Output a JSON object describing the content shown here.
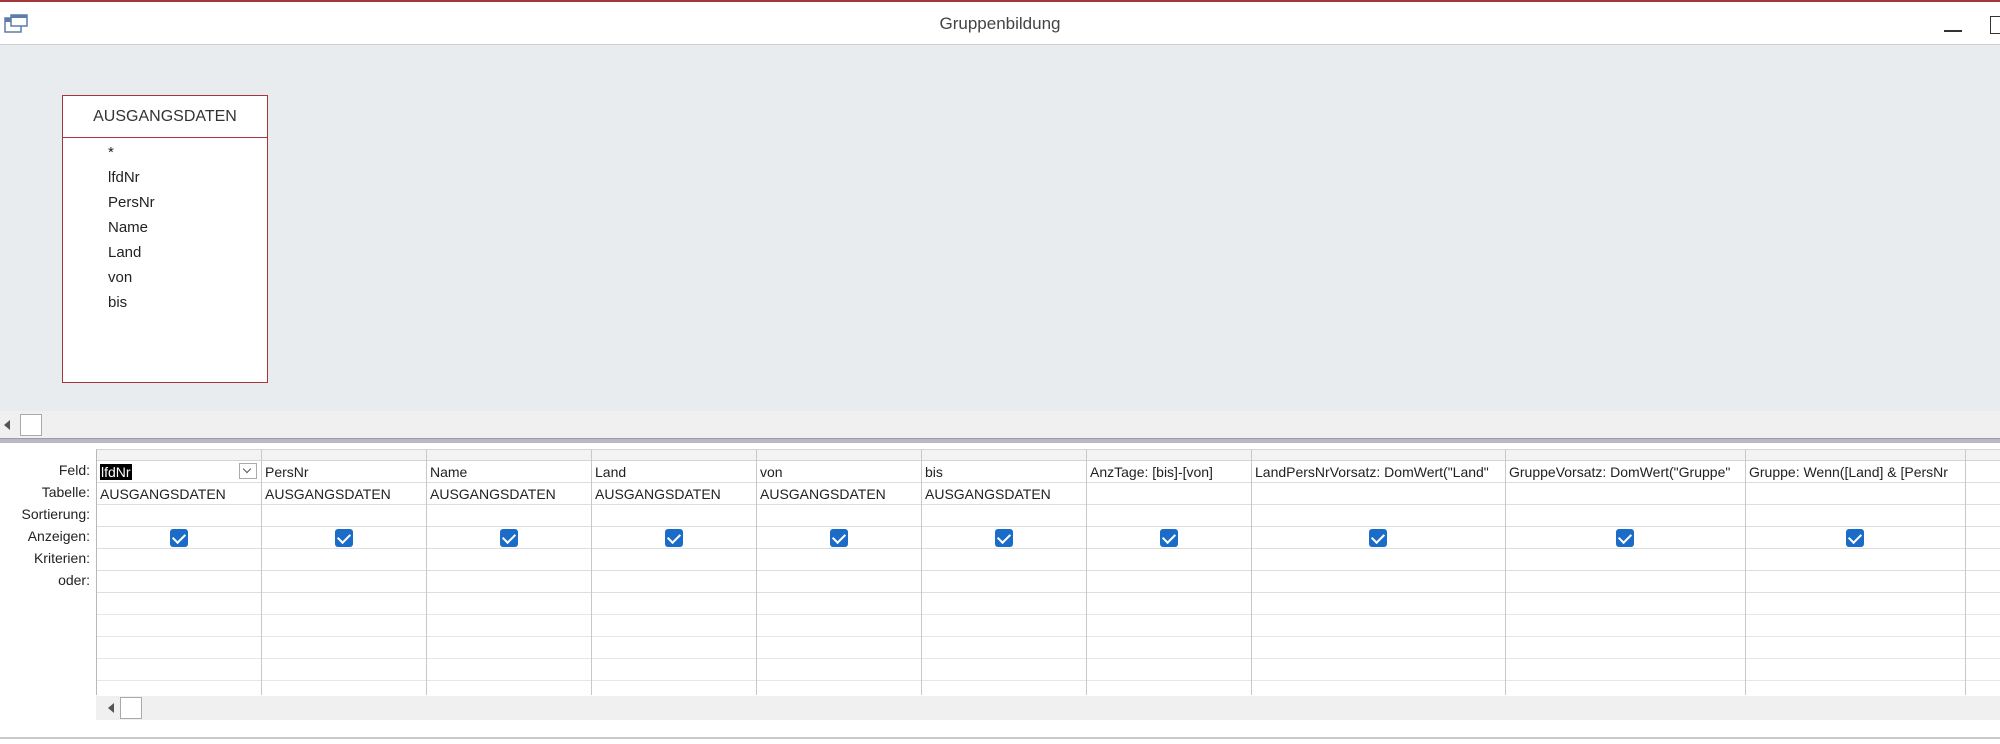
{
  "window": {
    "title": "Gruppenbildung"
  },
  "field_list": {
    "table_name": "AUSGANGSDATEN",
    "fields": [
      "*",
      "lfdNr",
      "PersNr",
      "Name",
      "Land",
      "von",
      "bis"
    ]
  },
  "grid": {
    "row_labels": [
      "Feld:",
      "Tabelle:",
      "Sortierung:",
      "Anzeigen:",
      "Kriterien:",
      "oder:"
    ],
    "columns": [
      {
        "field": "lfdNr",
        "table": "AUSGANGSDATEN",
        "show": true
      },
      {
        "field": "PersNr",
        "table": "AUSGANGSDATEN",
        "show": true
      },
      {
        "field": "Name",
        "table": "AUSGANGSDATEN",
        "show": true
      },
      {
        "field": "Land",
        "table": "AUSGANGSDATEN",
        "show": true
      },
      {
        "field": "von",
        "table": "AUSGANGSDATEN",
        "show": true
      },
      {
        "field": "bis",
        "table": "AUSGANGSDATEN",
        "show": true
      },
      {
        "field": "AnzTage: [bis]-[von]",
        "table": "",
        "show": true
      },
      {
        "field": "LandPersNrVorsatz: DomWert(\"Land\"",
        "table": "",
        "show": true
      },
      {
        "field": "GruppeVorsatz: DomWert(\"Gruppe\"",
        "table": "",
        "show": true
      },
      {
        "field": "Gruppe: Wenn([Land] & [PersNr",
        "table": "",
        "show": true
      }
    ]
  },
  "colors": {
    "accent": "#a4373a",
    "checkbox": "#1a6cc8",
    "design_background": "#e9ecef"
  }
}
